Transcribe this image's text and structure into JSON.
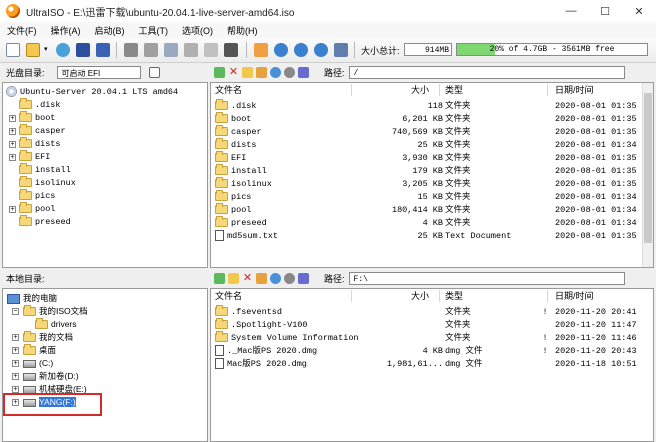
{
  "window": {
    "title": "UltraISO - E:\\迅雷下载\\ubuntu-20.04.1-live-server-amd64.iso",
    "min_label": "—",
    "max_label": "☐",
    "close_label": "✕"
  },
  "menu": [
    "文件(F)",
    "操作(A)",
    "启动(B)",
    "工具(T)",
    "选项(O)",
    "帮助(H)"
  ],
  "toolbar": {
    "total_size_label": "大小总计:",
    "total_size_value": "914MB",
    "capacity_text": "20% of 4.7GB - 3561MB free",
    "capacity_fraction": 0.2
  },
  "iso_panel": {
    "label": "光盘目录:",
    "boot_field": "可启动 EFI",
    "path_label": "路径:",
    "path_value": "/",
    "tree_root": "Ubuntu-Server 20.04.1 LTS amd64",
    "tree": [
      ".disk",
      "boot",
      "casper",
      "dists",
      "EFI",
      "install",
      "isolinux",
      "pics",
      "pool",
      "preseed"
    ],
    "columns": [
      "文件名",
      "大小",
      "类型",
      "日期/时间"
    ],
    "files": [
      {
        "name": ".disk",
        "size": "118",
        "type": "文件夹",
        "flag": "",
        "date": "2020-08-01 01:35"
      },
      {
        "name": "boot",
        "size": "6,201 KB",
        "type": "文件夹",
        "flag": "",
        "date": "2020-08-01 01:35"
      },
      {
        "name": "casper",
        "size": "740,569 KB",
        "type": "文件夹",
        "flag": "",
        "date": "2020-08-01 01:35"
      },
      {
        "name": "dists",
        "size": "25 KB",
        "type": "文件夹",
        "flag": "",
        "date": "2020-08-01 01:34"
      },
      {
        "name": "EFI",
        "size": "3,930 KB",
        "type": "文件夹",
        "flag": "",
        "date": "2020-08-01 01:35"
      },
      {
        "name": "install",
        "size": "179 KB",
        "type": "文件夹",
        "flag": "",
        "date": "2020-08-01 01:35"
      },
      {
        "name": "isolinux",
        "size": "3,205 KB",
        "type": "文件夹",
        "flag": "",
        "date": "2020-08-01 01:35"
      },
      {
        "name": "pics",
        "size": "15 KB",
        "type": "文件夹",
        "flag": "",
        "date": "2020-08-01 01:34"
      },
      {
        "name": "pool",
        "size": "180,414 KB",
        "type": "文件夹",
        "flag": "",
        "date": "2020-08-01 01:34"
      },
      {
        "name": "preseed",
        "size": "4 KB",
        "type": "文件夹",
        "flag": "",
        "date": "2020-08-01 01:34"
      },
      {
        "name": "md5sum.txt",
        "size": "25 KB",
        "type": "Text Document",
        "flag": "",
        "date": "2020-08-01 01:35"
      }
    ]
  },
  "local_panel": {
    "label": "本地目录:",
    "path_label": "路径:",
    "path_value": "F:\\",
    "tree": [
      {
        "label": "我的电脑",
        "kind": "computer",
        "indent": 0,
        "exp": ""
      },
      {
        "label": "我的ISO文档",
        "kind": "folder",
        "indent": 1,
        "exp": "−"
      },
      {
        "label": "drivers",
        "kind": "folder",
        "indent": 2,
        "exp": ""
      },
      {
        "label": "我的文档",
        "kind": "folder",
        "indent": 1,
        "exp": "+"
      },
      {
        "label": "桌面",
        "kind": "folder",
        "indent": 1,
        "exp": "+"
      },
      {
        "label": "(C:)",
        "kind": "disk",
        "indent": 1,
        "exp": "+"
      },
      {
        "label": "新加卷(D:)",
        "kind": "disk",
        "indent": 1,
        "exp": "+"
      },
      {
        "label": "机械硬盘(E:)",
        "kind": "disk",
        "indent": 1,
        "exp": "+"
      },
      {
        "label": "YANG(F:)",
        "kind": "disk",
        "indent": 1,
        "exp": "+"
      }
    ],
    "columns": [
      "文件名",
      "大小",
      "类型",
      "日期/时间"
    ],
    "files": [
      {
        "name": ".fseventsd",
        "size": "",
        "type": "文件夹",
        "flag": "!",
        "date": "2020-11-20 20:41"
      },
      {
        "name": ".Spotlight-V100",
        "size": "",
        "type": "文件夹",
        "flag": "",
        "date": "2020-11-20 11:47"
      },
      {
        "name": "System Volume Information",
        "size": "",
        "type": "文件夹",
        "flag": "!",
        "date": "2020-11-20 11:46"
      },
      {
        "name": "._Mac版PS 2020.dmg",
        "size": "4 KB",
        "type": "dmg 文件",
        "flag": "!",
        "date": "2020-11-20 20:43"
      },
      {
        "name": "Mac版PS 2020.dmg",
        "size": "1,981,61...",
        "type": "dmg 文件",
        "flag": "",
        "date": "2020-11-18 10:51"
      }
    ]
  }
}
